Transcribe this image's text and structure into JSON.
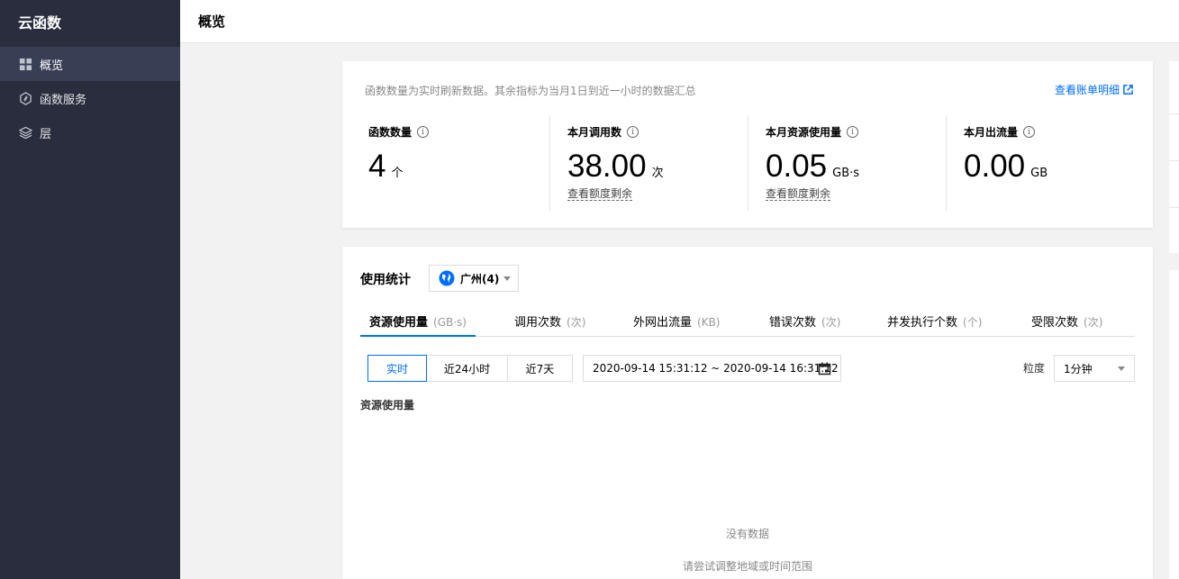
{
  "sidebar": {
    "brand": "云函数",
    "items": [
      {
        "label": "概览",
        "icon": "grid-icon",
        "active": true
      },
      {
        "label": "函数服务",
        "icon": "hexagon-icon",
        "active": false
      },
      {
        "label": "层",
        "icon": "layers-icon",
        "active": false
      }
    ]
  },
  "header": {
    "title": "概览"
  },
  "summary": {
    "note": "函数数量为实时刷新数据。其余指标为当月1日到近一小时的数据汇总",
    "billing_link": "查看账单明细",
    "metrics": [
      {
        "label": "函数数量",
        "value": "4",
        "unit": "个",
        "link": ""
      },
      {
        "label": "本月调用数",
        "value": "38.00",
        "unit": "次",
        "link": "查看额度剩余"
      },
      {
        "label": "本月资源使用量",
        "value": "0.05",
        "unit": "GB·s",
        "link": "查看额度剩余"
      },
      {
        "label": "本月出流量",
        "value": "0.00",
        "unit": "GB",
        "link": ""
      }
    ]
  },
  "stats": {
    "title": "使用统计",
    "region": "广州(4)",
    "tabs": [
      {
        "label": "资源使用量",
        "unit": "(GB·s)",
        "active": true
      },
      {
        "label": "调用次数",
        "unit": "(次)",
        "active": false
      },
      {
        "label": "外网出流量",
        "unit": "(KB)",
        "active": false
      },
      {
        "label": "错误次数",
        "unit": "(次)",
        "active": false
      },
      {
        "label": "并发执行个数",
        "unit": "(个)",
        "active": false
      },
      {
        "label": "受限次数",
        "unit": "(次)",
        "active": false
      }
    ],
    "time_buttons": [
      {
        "label": "实时",
        "active": true
      },
      {
        "label": "近24小时",
        "active": false
      },
      {
        "label": "近7天",
        "active": false
      }
    ],
    "date_range": "2020-09-14 15:31:12 ~ 2020-09-14 16:31:12",
    "granularity_label": "粒度",
    "granularity_value": "1分钟",
    "chart_title": "资源使用量",
    "empty_title": "没有数据",
    "empty_hint": "请尝试调整地域或时间范围"
  },
  "colors": {
    "sidebar_bg": "#292d3e",
    "sidebar_active": "#383f55",
    "accent": "#006eff"
  }
}
